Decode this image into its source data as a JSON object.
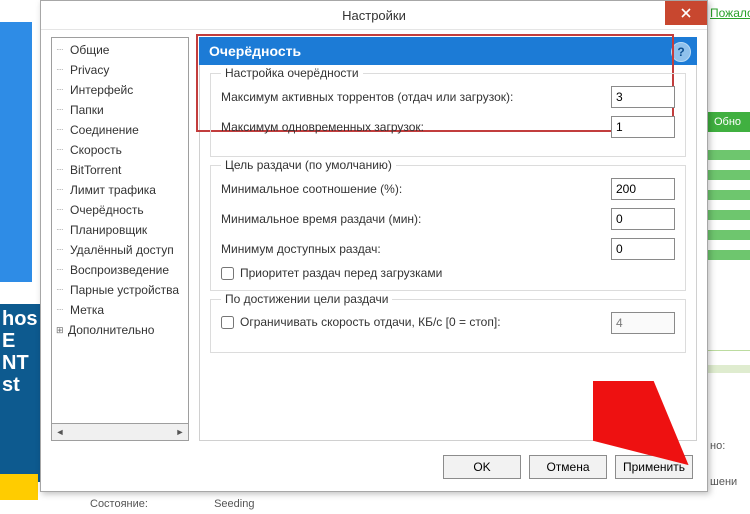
{
  "bg": {
    "link_top": "Пожало",
    "upd_btn": "Обно",
    "info1": "но:",
    "info2": "шени",
    "ad_lines": "hos\nE\nNT\nst",
    "bottom_label": "Состояние:",
    "bottom_value": "Seeding"
  },
  "dialog": {
    "title": "Настройки",
    "tree": {
      "items": [
        {
          "label": "Общие",
          "exp": false
        },
        {
          "label": "Privacy",
          "exp": false
        },
        {
          "label": "Интерфейс",
          "exp": false
        },
        {
          "label": "Папки",
          "exp": false
        },
        {
          "label": "Соединение",
          "exp": false
        },
        {
          "label": "Скорость",
          "exp": false
        },
        {
          "label": "BitTorrent",
          "exp": false
        },
        {
          "label": "Лимит трафика",
          "exp": false
        },
        {
          "label": "Очерёдность",
          "exp": false
        },
        {
          "label": "Планировщик",
          "exp": false
        },
        {
          "label": "Удалённый доступ",
          "exp": false
        },
        {
          "label": "Воспроизведение",
          "exp": false
        },
        {
          "label": "Парные устройства",
          "exp": false
        },
        {
          "label": "Метка",
          "exp": false
        },
        {
          "label": "Дополнительно",
          "exp": true
        }
      ]
    },
    "panel": {
      "title": "Очерёдность",
      "help": "?",
      "group1": {
        "legend": "Настройка очерёдности",
        "row1_label": "Максимум активных торрентов (отдач или загрузок):",
        "row1_value": "3",
        "row2_label": "Максимум одновременных загрузок:",
        "row2_value": "1"
      },
      "group2": {
        "legend": "Цель раздачи (по умолчанию)",
        "r1_label": "Минимальное соотношение (%):",
        "r1_value": "200",
        "r2_label": "Минимальное время раздачи (мин):",
        "r2_value": "0",
        "r3_label": "Минимум доступных раздач:",
        "r3_value": "0",
        "chk_label": "Приоритет раздач перед загрузками"
      },
      "group3": {
        "legend": "По достижении цели раздачи",
        "chk_label": "Ограничивать скорость отдачи, КБ/с [0 = стоп]:",
        "value": "4"
      }
    },
    "buttons": {
      "ok": "OK",
      "cancel": "Отмена",
      "apply": "Применить"
    }
  }
}
